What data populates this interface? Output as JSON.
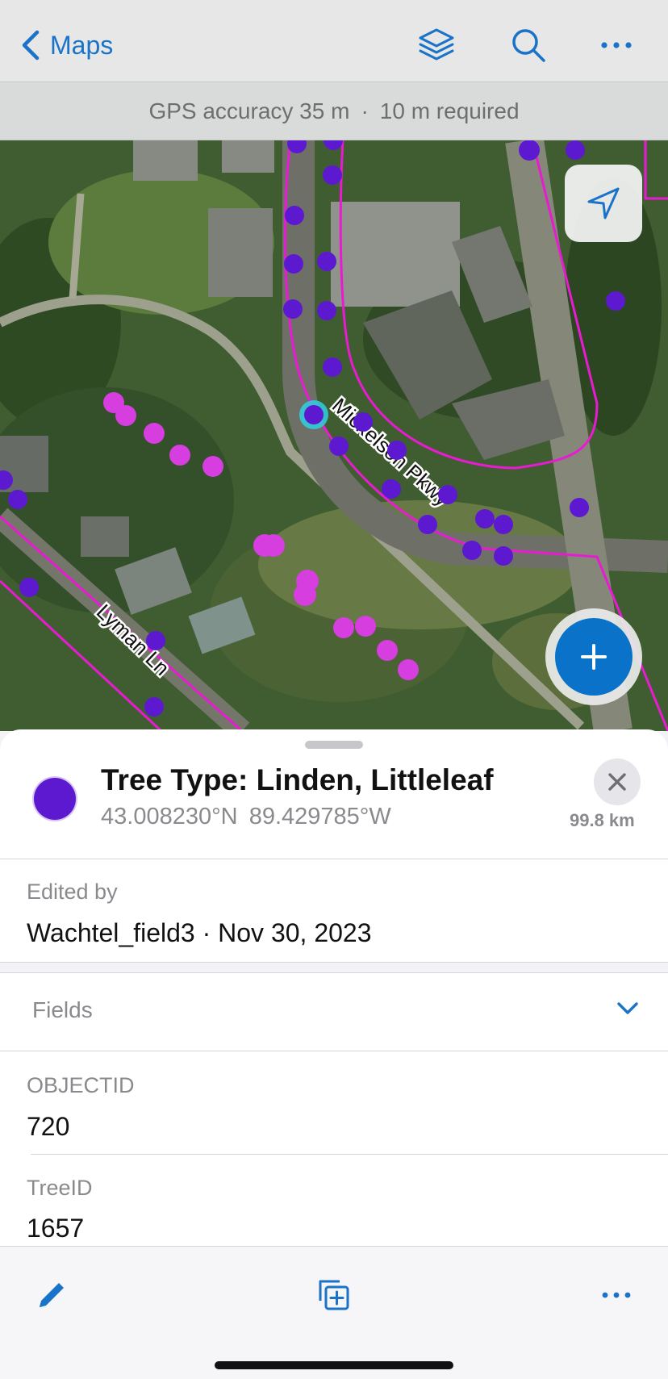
{
  "nav": {
    "back_label": "Maps",
    "icons": [
      "chevron-left-icon",
      "layers-icon",
      "search-icon",
      "more-icon"
    ]
  },
  "gps": {
    "accuracy": "GPS accuracy 35 m",
    "separator": "·",
    "required": "10 m required"
  },
  "map": {
    "road_labels": [
      "Mickelson Pkwy",
      "Lyman Ln"
    ],
    "point_colors": {
      "tree": "#5d19d0",
      "other": "#d63ee0",
      "selected_ring": "#2fd0e0",
      "boundary": "#e81bd2"
    },
    "icons": [
      "locate-arrow-icon",
      "plus-icon"
    ]
  },
  "feature": {
    "title": "Tree Type: Linden, Littleleaf",
    "latitude": "43.008230°N",
    "longitude": "89.429785°W",
    "distance": "99.8 km",
    "symbol_color": "#5d19d0"
  },
  "edited": {
    "label": "Edited by",
    "value": "Wachtel_field3 · Nov 30, 2023"
  },
  "fields_section": {
    "label": "Fields"
  },
  "fields": [
    {
      "name": "OBJECTID",
      "value": "720"
    },
    {
      "name": "TreeID",
      "value": "1657"
    }
  ],
  "toolbar": {
    "icons": [
      "pencil-icon",
      "duplicate-icon",
      "more-icon"
    ]
  },
  "colors": {
    "accent": "#1a73c8",
    "fab": "#0a73c9"
  }
}
